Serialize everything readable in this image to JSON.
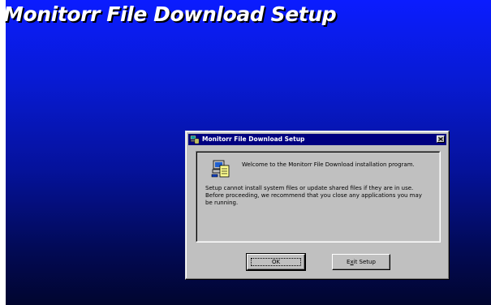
{
  "page_title": "Monitorr File Download Setup",
  "dialog": {
    "title": "Monitorr File Download Setup",
    "welcome": "Welcome to the Monitorr File Download installation program.",
    "body_lines": [
      "Setup cannot install system files or update shared files if they are in use.",
      "Before proceeding, we recommend that you close any applications you may",
      "be running."
    ],
    "ok_label": "OK",
    "exit_label_before": "E",
    "exit_label_access": "x",
    "exit_label_after": "it Setup"
  },
  "icons": {
    "titlebar": "setup-computer-icon",
    "close": "close-icon",
    "setup": "setup-computer-icon"
  },
  "colors": {
    "titlebar": "#000080",
    "background_top": "#0b1cff",
    "background_bottom": "#01052f",
    "dialog_face": "#c0c0c0"
  }
}
